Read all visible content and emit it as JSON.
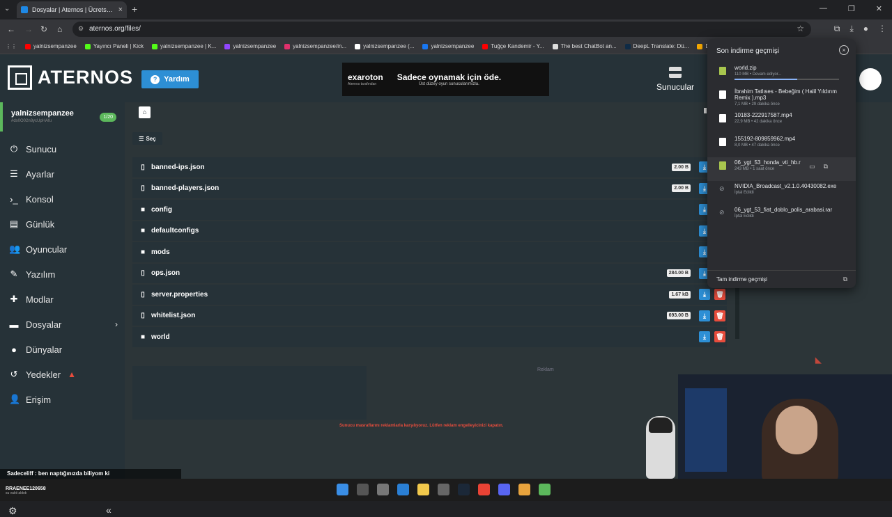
{
  "browser": {
    "tab_title": "Dosyalar | Aternos | Ücretsiz Mi",
    "url": "aternos.org/files/",
    "bookmarks": [
      {
        "label": "yalnizsempanzee",
        "color": "#ff0000"
      },
      {
        "label": "Yayıncı Paneli | Kick",
        "color": "#53fc18"
      },
      {
        "label": "yalnizsempanzee | K...",
        "color": "#53fc18"
      },
      {
        "label": "yalnizsempanzee",
        "color": "#9146ff"
      },
      {
        "label": "yalnizsempanzee/in...",
        "color": "#e1306c"
      },
      {
        "label": "yalnizsempanzee (...",
        "color": "#ffffff"
      },
      {
        "label": "yalnizsempanzee",
        "color": "#1877f2"
      },
      {
        "label": "Tuğçe Kandemir - Y...",
        "color": "#ff0000"
      },
      {
        "label": "The best ChatBot an...",
        "color": "#dddddd"
      },
      {
        "label": "DeepL Translate: Dü...",
        "color": "#0f2b46"
      },
      {
        "label": "Diğer İşaretleri",
        "color": "#f9ab00"
      }
    ]
  },
  "header": {
    "logo_text": "ATERNOS",
    "help_label": "Yardım",
    "ad": {
      "brand": "exaroton",
      "brand_sub": "Aternos tarafından",
      "headline": "Sadece oynamak için öde.",
      "subline": "Üst düzey oyun sunucularımızla."
    },
    "servers_label": "Sunucular"
  },
  "sidebar": {
    "server_name": "yalnizsempanzee",
    "server_id": "#ds0O02n8ycUpHAfu",
    "player_count": "1/20",
    "items": [
      {
        "label": "Sunucu",
        "icon": "power-icon"
      },
      {
        "label": "Ayarlar",
        "icon": "sliders-icon"
      },
      {
        "label": "Konsol",
        "icon": "terminal-icon"
      },
      {
        "label": "Günlük",
        "icon": "log-icon"
      },
      {
        "label": "Oyuncular",
        "icon": "users-icon"
      },
      {
        "label": "Yazılım",
        "icon": "puzzle-icon"
      },
      {
        "label": "Modlar",
        "icon": "puzzle-piece-icon"
      },
      {
        "label": "Dosyalar",
        "icon": "folder-icon"
      },
      {
        "label": "Dünyalar",
        "icon": "globe-icon"
      },
      {
        "label": "Yedekler",
        "icon": "history-icon"
      },
      {
        "label": "Erişim",
        "icon": "user-lock-icon"
      }
    ]
  },
  "files": {
    "select_label": "Seç",
    "rows": [
      {
        "name": "banned-ips.json",
        "type": "file",
        "size": "2.00 B"
      },
      {
        "name": "banned-players.json",
        "type": "file",
        "size": "2.00 B"
      },
      {
        "name": "config",
        "type": "folder",
        "size": ""
      },
      {
        "name": "defaultconfigs",
        "type": "folder",
        "size": ""
      },
      {
        "name": "mods",
        "type": "folder",
        "size": ""
      },
      {
        "name": "ops.json",
        "type": "file",
        "size": "284.00 B"
      },
      {
        "name": "server.properties",
        "type": "file",
        "size": "1.67 kB"
      },
      {
        "name": "whitelist.json",
        "type": "file",
        "size": "693.00 B"
      },
      {
        "name": "world",
        "type": "folder",
        "size": ""
      }
    ],
    "ad_label": "Reklam",
    "notice": "Sunucu masraflarını reklamlarla karşılıyoruz. Lütfen reklam engelleyicinizi kapatın."
  },
  "downloads": {
    "title": "Son indirme geçmişi",
    "items": [
      {
        "name": "world.zip",
        "meta": "110 MB • Devam ediyor...",
        "progress": 0.6,
        "icon_color": "#a8c64e"
      },
      {
        "name": "İbrahim Tatlıses - Bebeğim ( Halil Yıldırım Remix ).mp3",
        "meta": "7,1 MB • 29 dakika önce",
        "icon_color": "#ffffff"
      },
      {
        "name": "10183-222917587.mp4",
        "meta": "22,9 MB • 42 dakika önce",
        "icon_color": "#ffffff"
      },
      {
        "name": "155192-809859962.mp4",
        "meta": "8,0 MB • 47 dakika önce",
        "icon_color": "#ffffff"
      },
      {
        "name": "06_ygt_53_honda_vti_hb.r",
        "meta": "243 MB • 1 saat önce",
        "icon_color": "#a8c64e"
      },
      {
        "name": "NVIDIA_Broadcast_v2.1.0.40430082.exe",
        "meta": "İptal Edildi",
        "icon_color": ""
      },
      {
        "name": "06_ygt_53_fiat_doblo_polis_arabasi.rar",
        "meta": "İptal Edildi",
        "icon_color": ""
      }
    ],
    "footer": "Tam indirme geçmişi"
  },
  "overlay": {
    "chat_message": "Sadeceliff : ben naptığınızda biliyom ki",
    "taskbar_user": "RRAENEE120658",
    "taskbar_user_sub": "su vakti aldıdı"
  }
}
